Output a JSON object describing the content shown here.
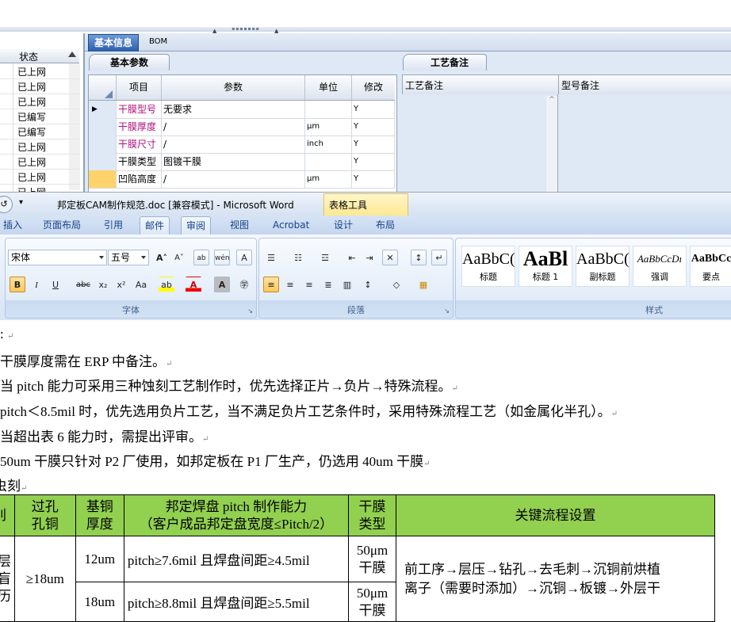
{
  "cam": {
    "status_header": "状态",
    "status_rows": [
      "已上网",
      "已上网",
      "已上网",
      "已编写",
      "已编写",
      "已上网",
      "已上网",
      "已上网",
      "已上网"
    ],
    "tabs": [
      "基本信息",
      "BOM"
    ],
    "subtab_params": "基本参数",
    "subtab_notes": "工艺备注",
    "grid_headers": [
      "项目",
      "参数",
      "单位",
      "修改"
    ],
    "grid_rows": [
      {
        "item": "干膜型号",
        "param": "无要求",
        "unit": "",
        "edit": "Y"
      },
      {
        "item": "干膜厚度",
        "param": "/",
        "unit": "μm",
        "edit": "Y"
      },
      {
        "item": "干膜尺寸",
        "param": "/",
        "unit": "inch",
        "edit": "Y"
      },
      {
        "item": "干膜类型",
        "param": "图镀干膜",
        "unit": "",
        "edit": "Y"
      },
      {
        "item": "凹陷高度",
        "param": "/",
        "unit": "μm",
        "edit": "Y"
      }
    ],
    "notes_headers": [
      "工艺备注",
      "型号备注"
    ]
  },
  "word": {
    "title": "邦定板CAM制作规范.doc [兼容模式] - Microsoft Word",
    "table_tools": "表格工具",
    "tabs": [
      "插入",
      "页面布局",
      "引用",
      "邮件",
      "审阅",
      "视图",
      "Acrobat",
      "设计",
      "布局"
    ],
    "font_name": "宋体",
    "font_size": "五号",
    "groups": {
      "font": "字体",
      "paragraph": "段落",
      "styles": "样式"
    },
    "styles": [
      {
        "preview": "AaBbC(",
        "label": "标题"
      },
      {
        "preview": "AaBl",
        "label": "标题 1"
      },
      {
        "preview": "AaBbC(",
        "label": "副标题"
      },
      {
        "preview": "AaBbCcDı",
        "label": "强调"
      },
      {
        "preview": "AaBbCc",
        "label": "要点"
      }
    ]
  },
  "doc": {
    "lines": [
      ":",
      "干膜厚度需在 ERP 中备注。",
      "当 pitch 能力可采用三种蚀刻工艺制作时，优先选择正片→负片→特殊流程。",
      "pitch＜8.5mil 时，优先选用负片工艺，当不满足负片工艺条件时，采用特殊流程工艺（如金属化半孔）。",
      "当超出表 6 能力时，需提出评审。",
      "50um 干膜只针对 P2 厂使用，如邦定板在 P1 厂生产，仍选用 40um 干膜",
      "虫刻"
    ],
    "para_mark": "↵",
    "table": {
      "headers": [
        "刖",
        "过孔\n孔铜",
        "基铜\n厚度",
        "邦定焊盘 pitch 制作能力\n（客户成品邦定盘宽度≤Pitch/2）",
        "干膜\n类型",
        "关键流程设置"
      ],
      "rows": [
        {
          "col0": "层\n盲\n历",
          "hole": "≥18um",
          "base": "12um",
          "pitch": "pitch≥7.6mil 且焊盘间距≥4.5mil",
          "film": "50μm\n干膜",
          "flow": "前工序→层压→钻孔→去毛刺→沉铜前烘植\n离子（需要时添加）→沉铜→板镀→外层干"
        },
        {
          "base": "18um",
          "pitch": "pitch≥8.8mil 且焊盘间距≥5.5mil",
          "film": "50μm\n干膜"
        }
      ]
    }
  }
}
